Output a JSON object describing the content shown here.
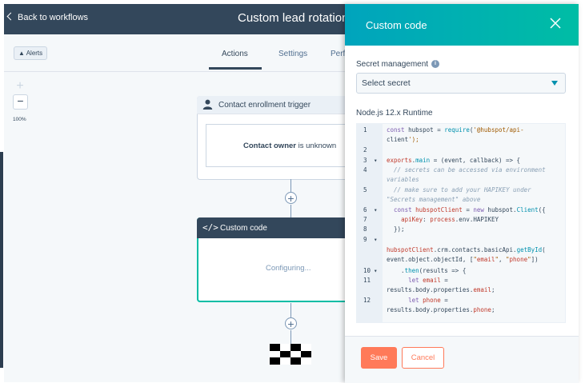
{
  "header": {
    "back_label": "Back to workflows",
    "workflow_title": "Custom lead rotation"
  },
  "subnav": {
    "alerts_label": "Alerts",
    "tabs": [
      {
        "label": "Actions",
        "active": true
      },
      {
        "label": "Settings",
        "active": false
      },
      {
        "label": "Perf",
        "active": false
      }
    ]
  },
  "canvas": {
    "zoom_plus": "+",
    "zoom_minus": "−",
    "zoom_level": "100%",
    "trigger": {
      "title": "Contact enrollment trigger",
      "condition_property": "Contact owner",
      "condition_operator": "is unknown"
    },
    "add_button": "+",
    "action": {
      "icon": "</>",
      "title": "Custom code",
      "status": "Configuring..."
    }
  },
  "panel": {
    "title": "Custom code",
    "secret_label": "Secret management",
    "info_glyph": "i",
    "secret_placeholder": "Select secret",
    "runtime_label": "Node.js 12.x Runtime",
    "code_lines": [
      {
        "n": "1",
        "fold": "",
        "text": "const hubspot = require('@hubspot/api-"
      },
      {
        "n": "",
        "fold": "",
        "text": "client');"
      },
      {
        "n": "2",
        "fold": "",
        "text": ""
      },
      {
        "n": "3",
        "fold": "▾",
        "text": "exports.main = (event, callback) => {"
      },
      {
        "n": "4",
        "fold": "",
        "text": "  // secrets can be accessed via environment"
      },
      {
        "n": "",
        "fold": "",
        "text": "variables"
      },
      {
        "n": "5",
        "fold": "",
        "text": "  // make sure to add your HAPIKEY under"
      },
      {
        "n": "",
        "fold": "",
        "text": "\"Secrets management\" above"
      },
      {
        "n": "6",
        "fold": "▾",
        "text": "  const hubspotClient = new hubspot.Client({"
      },
      {
        "n": "7",
        "fold": "",
        "text": "    apiKey: process.env.HAPIKEY"
      },
      {
        "n": "8",
        "fold": "",
        "text": "  });"
      },
      {
        "n": "9",
        "fold": "▾",
        "text": ""
      },
      {
        "n": "",
        "fold": "",
        "text": "hubspotClient.crm.contacts.basicApi.getById("
      },
      {
        "n": "",
        "fold": "",
        "text": "event.object.objectId, [\"email\", \"phone\"])"
      },
      {
        "n": "10",
        "fold": "▾",
        "text": "    .then(results => {"
      },
      {
        "n": "11",
        "fold": "",
        "text": "      let email ="
      },
      {
        "n": "",
        "fold": "",
        "text": "results.body.properties.email;"
      },
      {
        "n": "12",
        "fold": "",
        "text": "      let phone ="
      },
      {
        "n": "",
        "fold": "",
        "text": "results.body.properties.phone;"
      }
    ],
    "save_label": "Save",
    "cancel_label": "Cancel"
  },
  "colors": {
    "header_bg": "#33475b",
    "accent_teal": "#00bda5",
    "save_orange": "#ff7a59"
  }
}
